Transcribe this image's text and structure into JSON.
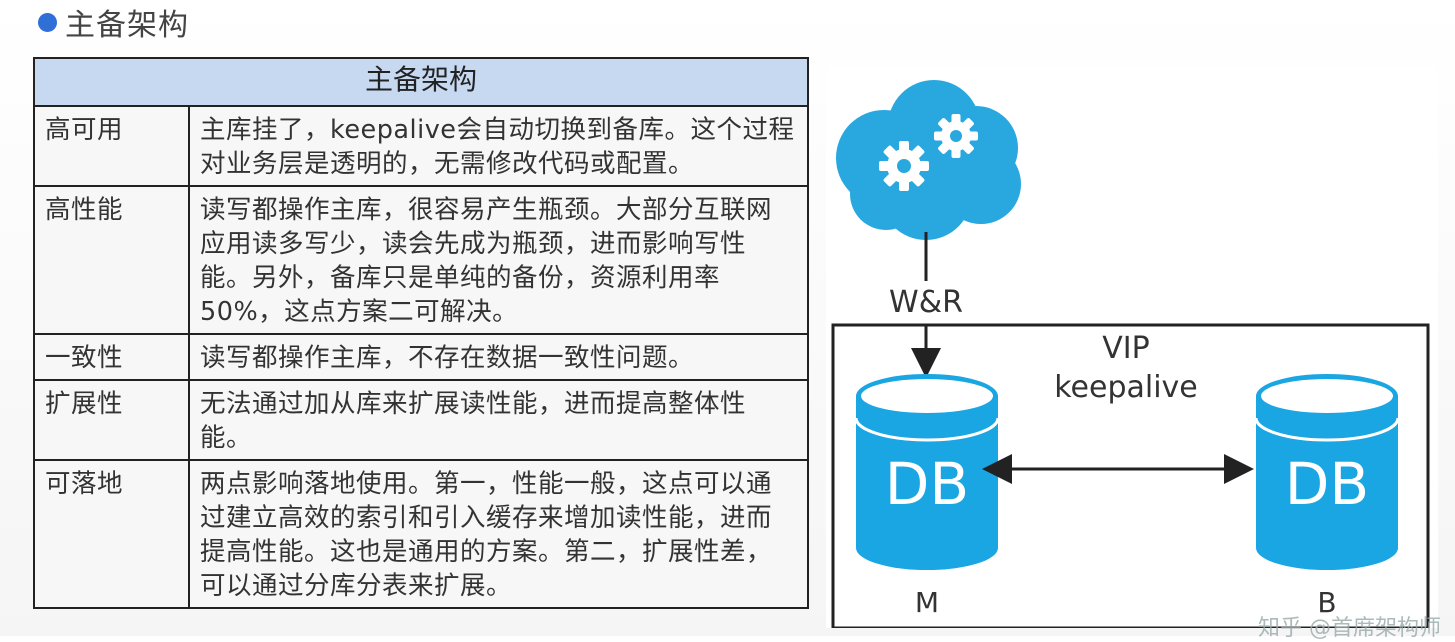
{
  "heading": {
    "title": "主备架构",
    "bullet_color": "#2f6fd6"
  },
  "table": {
    "header": "主备架构",
    "header_bg": "#c6d9f1",
    "rows": [
      {
        "category": "高可用",
        "description": "主库挂了，keepalive会自动切换到备库。这个过程对业务层是透明的，无需修改代码或配置。"
      },
      {
        "category": "高性能",
        "description": "读写都操作主库，很容易产生瓶颈。大部分互联网应用读多写少，读会先成为瓶颈，进而影响写性能。另外，备库只是单纯的备份，资源利用率50%，这点方案二可解决。"
      },
      {
        "category": "一致性",
        "description": "读写都操作主库，不存在数据一致性问题。"
      },
      {
        "category": "扩展性",
        "description": "无法通过加从库来扩展读性能，进而提高整体性能。"
      },
      {
        "category": "可落地",
        "description": "两点影响落地使用。第一，性能一般，这点可以通过建立高效的索引和引入缓存来增加读性能，进而提高性能。这也是通用的方案。第二，扩展性差，可以通过分库分表来扩展。"
      }
    ]
  },
  "diagram": {
    "cloud_icon": "cloud-gears-icon",
    "cloud_color": "#29a8e0",
    "db_color": "#1aa5e3",
    "link_label": "W&R",
    "vip_label": "VIP",
    "keepalive_label": "keepalive",
    "master_db": {
      "label": "DB",
      "caption": "M"
    },
    "backup_db": {
      "label": "DB",
      "caption": "B"
    }
  },
  "watermark": "知乎 @首席架构师"
}
